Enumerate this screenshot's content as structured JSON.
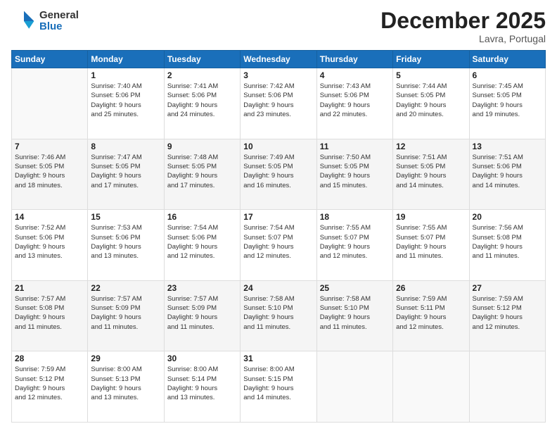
{
  "logo": {
    "general": "General",
    "blue": "Blue"
  },
  "title": "December 2025",
  "location": "Lavra, Portugal",
  "days_of_week": [
    "Sunday",
    "Monday",
    "Tuesday",
    "Wednesday",
    "Thursday",
    "Friday",
    "Saturday"
  ],
  "weeks": [
    [
      {
        "day": "",
        "info": ""
      },
      {
        "day": "1",
        "info": "Sunrise: 7:40 AM\nSunset: 5:06 PM\nDaylight: 9 hours\nand 25 minutes."
      },
      {
        "day": "2",
        "info": "Sunrise: 7:41 AM\nSunset: 5:06 PM\nDaylight: 9 hours\nand 24 minutes."
      },
      {
        "day": "3",
        "info": "Sunrise: 7:42 AM\nSunset: 5:06 PM\nDaylight: 9 hours\nand 23 minutes."
      },
      {
        "day": "4",
        "info": "Sunrise: 7:43 AM\nSunset: 5:06 PM\nDaylight: 9 hours\nand 22 minutes."
      },
      {
        "day": "5",
        "info": "Sunrise: 7:44 AM\nSunset: 5:05 PM\nDaylight: 9 hours\nand 20 minutes."
      },
      {
        "day": "6",
        "info": "Sunrise: 7:45 AM\nSunset: 5:05 PM\nDaylight: 9 hours\nand 19 minutes."
      }
    ],
    [
      {
        "day": "7",
        "info": "Sunrise: 7:46 AM\nSunset: 5:05 PM\nDaylight: 9 hours\nand 18 minutes."
      },
      {
        "day": "8",
        "info": "Sunrise: 7:47 AM\nSunset: 5:05 PM\nDaylight: 9 hours\nand 17 minutes."
      },
      {
        "day": "9",
        "info": "Sunrise: 7:48 AM\nSunset: 5:05 PM\nDaylight: 9 hours\nand 17 minutes."
      },
      {
        "day": "10",
        "info": "Sunrise: 7:49 AM\nSunset: 5:05 PM\nDaylight: 9 hours\nand 16 minutes."
      },
      {
        "day": "11",
        "info": "Sunrise: 7:50 AM\nSunset: 5:05 PM\nDaylight: 9 hours\nand 15 minutes."
      },
      {
        "day": "12",
        "info": "Sunrise: 7:51 AM\nSunset: 5:05 PM\nDaylight: 9 hours\nand 14 minutes."
      },
      {
        "day": "13",
        "info": "Sunrise: 7:51 AM\nSunset: 5:06 PM\nDaylight: 9 hours\nand 14 minutes."
      }
    ],
    [
      {
        "day": "14",
        "info": "Sunrise: 7:52 AM\nSunset: 5:06 PM\nDaylight: 9 hours\nand 13 minutes."
      },
      {
        "day": "15",
        "info": "Sunrise: 7:53 AM\nSunset: 5:06 PM\nDaylight: 9 hours\nand 13 minutes."
      },
      {
        "day": "16",
        "info": "Sunrise: 7:54 AM\nSunset: 5:06 PM\nDaylight: 9 hours\nand 12 minutes."
      },
      {
        "day": "17",
        "info": "Sunrise: 7:54 AM\nSunset: 5:07 PM\nDaylight: 9 hours\nand 12 minutes."
      },
      {
        "day": "18",
        "info": "Sunrise: 7:55 AM\nSunset: 5:07 PM\nDaylight: 9 hours\nand 12 minutes."
      },
      {
        "day": "19",
        "info": "Sunrise: 7:55 AM\nSunset: 5:07 PM\nDaylight: 9 hours\nand 11 minutes."
      },
      {
        "day": "20",
        "info": "Sunrise: 7:56 AM\nSunset: 5:08 PM\nDaylight: 9 hours\nand 11 minutes."
      }
    ],
    [
      {
        "day": "21",
        "info": "Sunrise: 7:57 AM\nSunset: 5:08 PM\nDaylight: 9 hours\nand 11 minutes."
      },
      {
        "day": "22",
        "info": "Sunrise: 7:57 AM\nSunset: 5:09 PM\nDaylight: 9 hours\nand 11 minutes."
      },
      {
        "day": "23",
        "info": "Sunrise: 7:57 AM\nSunset: 5:09 PM\nDaylight: 9 hours\nand 11 minutes."
      },
      {
        "day": "24",
        "info": "Sunrise: 7:58 AM\nSunset: 5:10 PM\nDaylight: 9 hours\nand 11 minutes."
      },
      {
        "day": "25",
        "info": "Sunrise: 7:58 AM\nSunset: 5:10 PM\nDaylight: 9 hours\nand 11 minutes."
      },
      {
        "day": "26",
        "info": "Sunrise: 7:59 AM\nSunset: 5:11 PM\nDaylight: 9 hours\nand 12 minutes."
      },
      {
        "day": "27",
        "info": "Sunrise: 7:59 AM\nSunset: 5:12 PM\nDaylight: 9 hours\nand 12 minutes."
      }
    ],
    [
      {
        "day": "28",
        "info": "Sunrise: 7:59 AM\nSunset: 5:12 PM\nDaylight: 9 hours\nand 12 minutes."
      },
      {
        "day": "29",
        "info": "Sunrise: 8:00 AM\nSunset: 5:13 PM\nDaylight: 9 hours\nand 13 minutes."
      },
      {
        "day": "30",
        "info": "Sunrise: 8:00 AM\nSunset: 5:14 PM\nDaylight: 9 hours\nand 13 minutes."
      },
      {
        "day": "31",
        "info": "Sunrise: 8:00 AM\nSunset: 5:15 PM\nDaylight: 9 hours\nand 14 minutes."
      },
      {
        "day": "",
        "info": ""
      },
      {
        "day": "",
        "info": ""
      },
      {
        "day": "",
        "info": ""
      }
    ]
  ]
}
